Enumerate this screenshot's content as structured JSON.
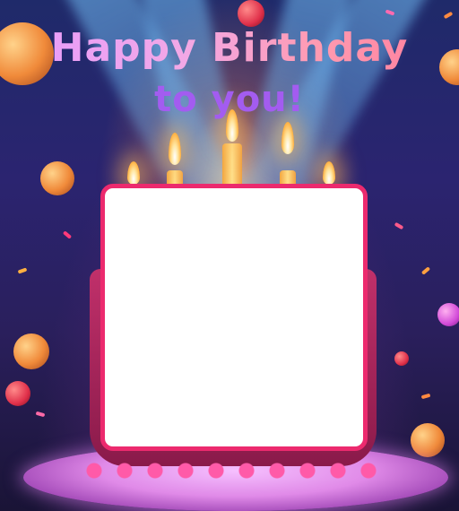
{
  "greeting": {
    "title": "Happy Birthday",
    "subtitle": "to you!"
  },
  "photo_frame": {
    "border_color": "#ec2a6e",
    "fill_color": "#ffffff"
  },
  "colors": {
    "title_gradient": [
      "#e69bff",
      "#ff7a9a"
    ],
    "subtitle": "#a35cf0"
  }
}
